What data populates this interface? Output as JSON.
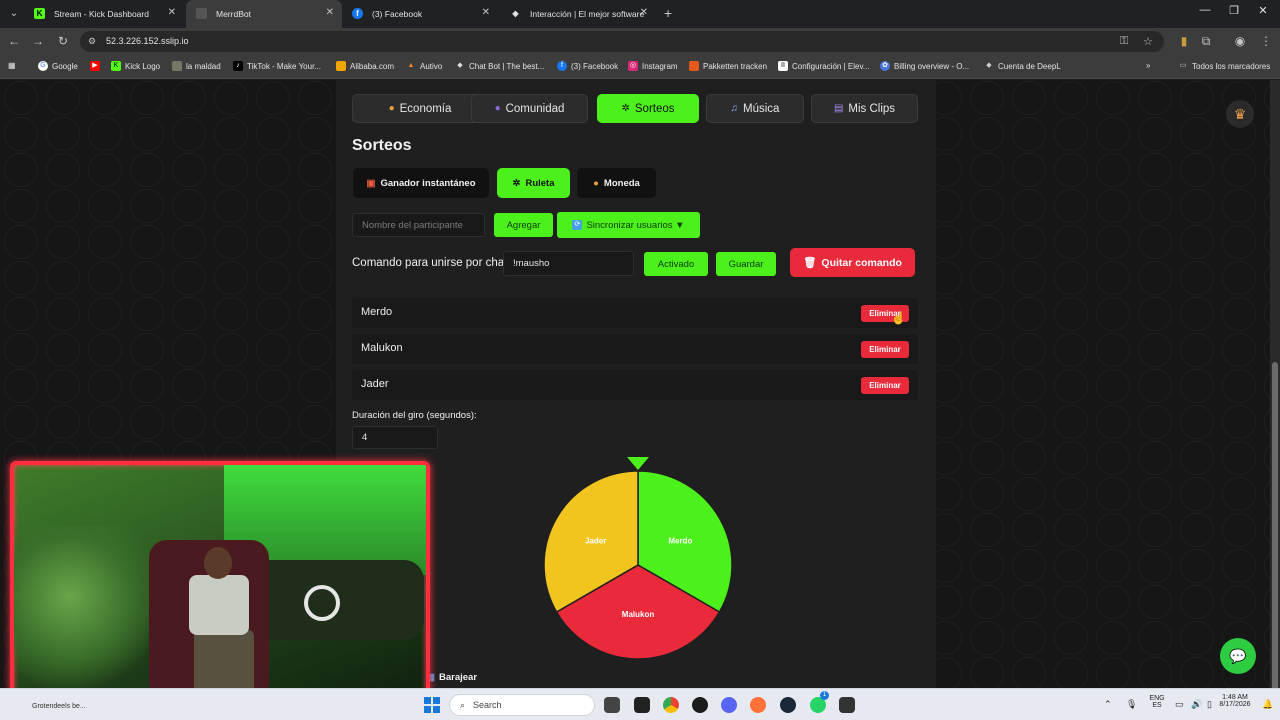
{
  "browser": {
    "tabs": [
      {
        "title": "Stream - Kick Dashboard",
        "icon": "kick-icon",
        "active": false
      },
      {
        "title": "MerrdBot",
        "icon": "page-icon",
        "active": true
      },
      {
        "title": "(3) Facebook",
        "icon": "facebook-icon",
        "active": false
      },
      {
        "title": "Interacción | El mejor software",
        "icon": "diamond-icon",
        "active": false
      }
    ],
    "url": "52.3.226.152.sslip.io",
    "bookmarks": [
      "Google",
      "Kick Logo",
      "la maldad",
      "TikTok - Make Your...",
      "Alibaba.com",
      "Autivo",
      "Chat Bot | The best...",
      "(3) Facebook",
      "Instagram",
      "Pakketten tracken",
      "Configuración | Elev...",
      "Billing overview - O...",
      "Cuenta de DeepL"
    ],
    "all_bookmarks": "Todos los marcadores"
  },
  "nav": {
    "items": [
      {
        "label": "Economía",
        "icon": "money-bag-icon",
        "active": false
      },
      {
        "label": "Comunidad",
        "icon": "people-icon",
        "active": false
      },
      {
        "label": "Sorteos",
        "icon": "sparkle-icon",
        "active": true
      },
      {
        "label": "Música",
        "icon": "music-note-icon",
        "active": false
      },
      {
        "label": "Mis Clips",
        "icon": "clip-icon",
        "active": false
      }
    ]
  },
  "sorteos": {
    "title": "Sorteos",
    "modes": [
      {
        "label": "Ganador instantáneo",
        "icon": "gift-icon",
        "active": false
      },
      {
        "label": "Ruleta",
        "icon": "sparkle-icon",
        "active": true
      },
      {
        "label": "Moneda",
        "icon": "coin-icon",
        "active": false
      }
    ],
    "participant_placeholder": "Nombre del participante",
    "add_label": "Agregar",
    "sync_label": "Sincronizar usuarios ▼",
    "command_label": "Comando para unirse por chat:",
    "command_value": "!mausho",
    "activated_label": "Activado",
    "save_label": "Guardar",
    "remove_command_label": "Quitar comando",
    "participants": [
      {
        "name": "Merdo",
        "delete_label": "Eliminar"
      },
      {
        "name": "Malukon",
        "delete_label": "Eliminar"
      },
      {
        "name": "Jader",
        "delete_label": "Eliminar"
      }
    ],
    "spin_duration_label": "Duración del giro (segundos):",
    "spin_duration_value": "4",
    "shuffle_label": "Barajear"
  },
  "wheel": {
    "segments": [
      {
        "name": "Merdo",
        "color": "#4cf01a"
      },
      {
        "name": "Malukon",
        "color": "#e92a3b"
      },
      {
        "name": "Jader",
        "color": "#f2c51e"
      }
    ],
    "pointer_color": "#4cf01a"
  },
  "taskbar": {
    "left_text": "Grotendeels be...",
    "search_placeholder": "Search",
    "lang": "ENG",
    "lang_sub": "ES",
    "time": "1:48 AM",
    "date": "8/17/2026",
    "whatsapp_badge": "1"
  },
  "colors": {
    "accent": "#4cf01a",
    "danger": "#e92a3b",
    "panel": "#1f1f1f"
  }
}
